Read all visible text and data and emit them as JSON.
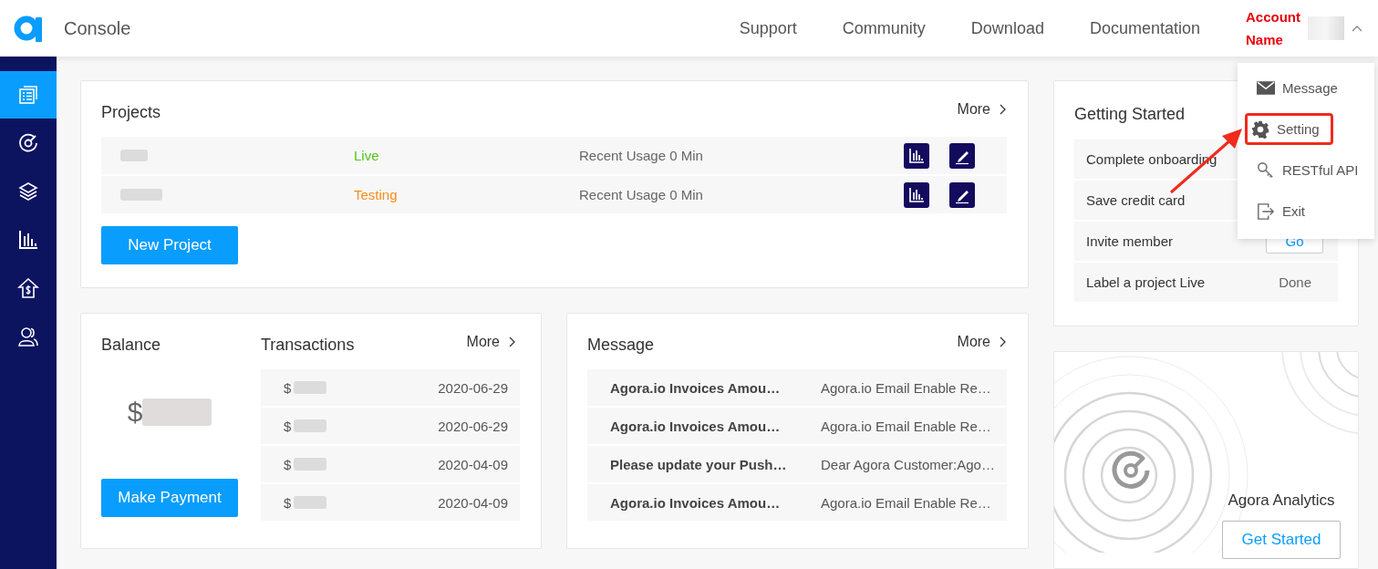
{
  "header": {
    "title": "Console",
    "nav": [
      "Support",
      "Community",
      "Download",
      "Documentation"
    ],
    "account": "Account Name",
    "menu_expanded": true
  },
  "account_menu": [
    {
      "label": "Message",
      "highlighted": false
    },
    {
      "label": "Setting",
      "highlighted": true
    },
    {
      "label": "RESTful API",
      "highlighted": false
    },
    {
      "label": "Exit",
      "highlighted": false
    }
  ],
  "sidebar": [
    {
      "selected": true
    },
    {
      "selected": false
    },
    {
      "selected": false
    },
    {
      "selected": false
    },
    {
      "selected": false
    },
    {
      "selected": false
    }
  ],
  "projects": {
    "title": "Projects",
    "more": "More",
    "rows": [
      {
        "status": "Live",
        "color": "#52c41a",
        "usage": "Recent Usage 0 Min"
      },
      {
        "status": "Testing",
        "color": "#fa8c16",
        "usage": "Recent Usage 0 Min"
      }
    ],
    "button": "New Project"
  },
  "balance": {
    "title": "Balance",
    "symbol": "$",
    "button": "Make Payment"
  },
  "transactions": {
    "title": "Transactions",
    "more": "More",
    "rows": [
      {
        "symbol": "$",
        "date": "2020-06-29"
      },
      {
        "symbol": "$",
        "date": "2020-06-29"
      },
      {
        "symbol": "$",
        "date": "2020-04-09"
      },
      {
        "symbol": "$",
        "date": "2020-04-09"
      }
    ]
  },
  "message": {
    "title": "Message",
    "more": "More",
    "rows": [
      {
        "subject": "Agora.io Invoices Amou…",
        "preview": "Agora.io Email Enable Re…"
      },
      {
        "subject": "Agora.io Invoices Amou…",
        "preview": "Agora.io Email Enable Re…"
      },
      {
        "subject": "Please update your Push…",
        "preview": "Dear Agora Customer:Ago…"
      },
      {
        "subject": "Agora.io Invoices Amou…",
        "preview": "Agora.io Email Enable Re…"
      }
    ]
  },
  "getting_started": {
    "title": "Getting Started",
    "rows": [
      {
        "label": "Complete onboarding"
      },
      {
        "label": "Save credit card"
      },
      {
        "label": "Invite member",
        "action": {
          "kind": "button",
          "label": "Go"
        }
      },
      {
        "label": "Label a project Live",
        "action": {
          "kind": "status",
          "label": "Done"
        }
      }
    ]
  },
  "analytics": {
    "title": "Agora Analytics",
    "button": "Get Started"
  }
}
